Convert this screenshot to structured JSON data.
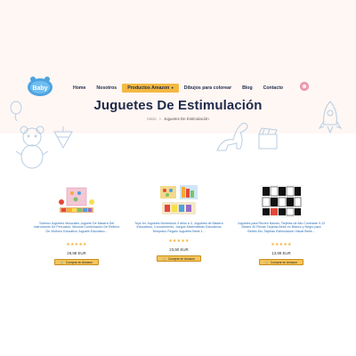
{
  "site": {
    "logo_text": "Baby"
  },
  "nav": {
    "items": [
      {
        "label": "Home"
      },
      {
        "label": "Nosotros"
      },
      {
        "label": "Productos Amazon",
        "active": true,
        "chevron": "▾"
      },
      {
        "label": "Dibujos para colorear"
      },
      {
        "label": "Blog"
      },
      {
        "label": "Contacto"
      }
    ],
    "language_icon": "flag-icon"
  },
  "page": {
    "title": "Juguetes De Estimulación",
    "breadcrumb_home": "Inicio",
    "breadcrumb_separator": "»",
    "breadcrumb_current": "Juguetes De Estimulación"
  },
  "products": [
    {
      "title": "Todmnu Juguetes Musicales Juguete De Madera Del Instrumento De Percusión, Musical Combinación De Relleno De Xilófono Educativo Juguete Educativo...",
      "rating": 5,
      "stars": "★★★★★",
      "price": "29,98 EUR",
      "button": "Comprar en Amazon"
    },
    {
      "title": "Toys for Juguetes Montessori 4 años a 3, Juguetes de Madera Educativos, Conocimiento, Juegos Matemáticas Educativos Temprano Regalo Juguetes Bebé 1...",
      "rating": 5,
      "stars": "★★★★★",
      "price": "23,90 EUR",
      "button": "Comprar en Amazon"
    },
    {
      "title": "Juguetes para Recién Nacido, Tarjetas de Alto Contraste 0-12 Meses 30 Piezas Tarjetas Bebé en Blanco y Negro para Bebés Mo, Tarjetas Estimulación Visual Bebé...",
      "rating": 5,
      "stars": "★★★★★",
      "price": "13,99 EUR",
      "button": "Comprar en Amazon"
    }
  ],
  "colors": {
    "header_bg": "#fff7f4",
    "nav_active": "#f4b942",
    "title": "#1e2a4a",
    "link": "#2d6fb5",
    "star": "#f2b33d",
    "amazon_button": "#f6c659"
  }
}
